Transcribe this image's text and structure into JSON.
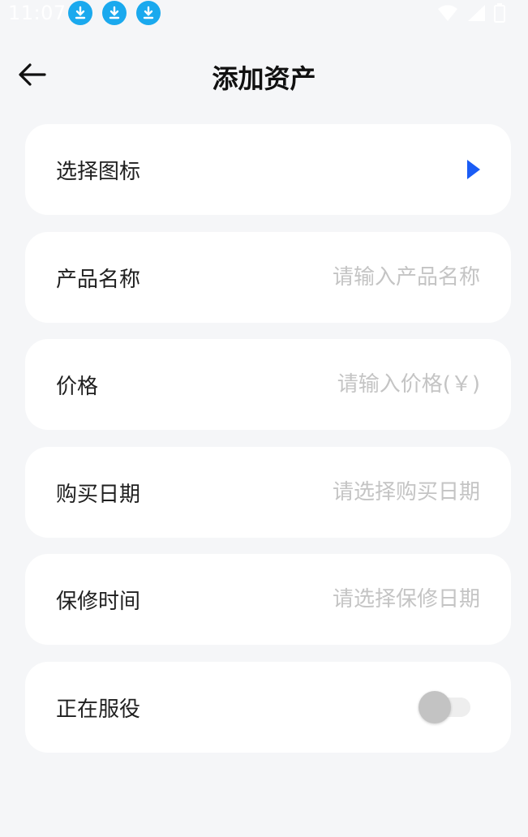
{
  "status_bar": {
    "time": "11:07",
    "download_icons": [
      "download-icon",
      "download-icon",
      "download-icon"
    ]
  },
  "header": {
    "title": "添加资产",
    "back_icon": "arrow-left-icon"
  },
  "form": {
    "icon_row": {
      "label": "选择图标",
      "icon": "triangle-right-icon"
    },
    "name_row": {
      "label": "产品名称",
      "placeholder": "请输入产品名称"
    },
    "price_row": {
      "label": "价格",
      "placeholder": "请输入价格(￥)"
    },
    "purchase_date_row": {
      "label": "购买日期",
      "placeholder": "请选择购买日期"
    },
    "warranty_row": {
      "label": "保修时间",
      "placeholder": "请选择保修日期"
    },
    "in_service_row": {
      "label": "正在服役",
      "toggle_on": false
    }
  },
  "colors": {
    "background": "#f5f6f8",
    "card": "#ffffff",
    "accent": "#1a5cf5",
    "placeholder": "#c4c4c4",
    "download_badge": "#1aa9ee"
  }
}
